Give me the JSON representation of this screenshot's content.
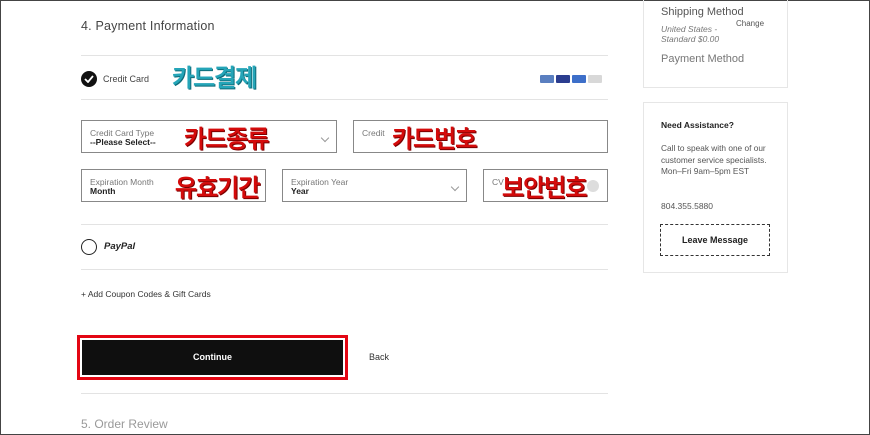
{
  "payment": {
    "section_title": "4. Payment Information",
    "credit_card_label": "Credit Card",
    "credit_card_annotation": "카드결제",
    "fields": {
      "card_type": {
        "label": "Credit Card Type",
        "value": "--Please Select--",
        "annotation": "카드종류"
      },
      "card_number": {
        "label": "Credit",
        "annotation": "카드번호"
      },
      "exp_month": {
        "label": "Expiration Month",
        "value": "Month",
        "annotation": "유효기간"
      },
      "exp_year": {
        "label": "Expiration Year",
        "value": "Year"
      },
      "cvv": {
        "label": "CV",
        "annotation": "보안번호"
      }
    },
    "paypal_label": "PayPal",
    "coupon_link": "+ Add Coupon Codes & Gift Cards",
    "continue_label": "Continue",
    "back_label": "Back",
    "next_section": "5. Order Review"
  },
  "summary": {
    "shipping_title": "Shipping Method",
    "change_label": "Change",
    "shipping_detail": "United States - Standard $0.00",
    "payment_title": "Payment Method"
  },
  "assist": {
    "title": "Need Assistance?",
    "body": "Call to speak with one of our customer service specialists. Mon–Fri 9am–5pm EST",
    "phone": "804.355.5880",
    "leave_message": "Leave Message"
  },
  "colors": {
    "annotation_teal": "#25a5b8",
    "annotation_red": "#d40b0b",
    "highlight_border": "#e30613",
    "button_bg": "#0f0f0f"
  },
  "icons": [
    "checkmark-icon",
    "chevron-down-icon",
    "card-logos-icon"
  ]
}
